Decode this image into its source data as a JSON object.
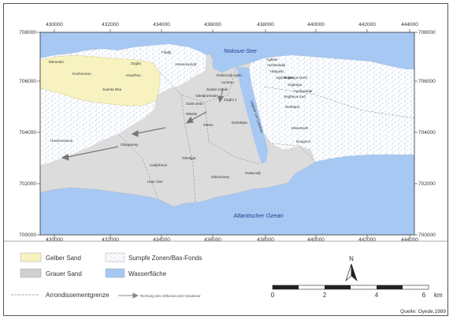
{
  "map": {
    "axes": {
      "x_ticks": [
        "430000",
        "432000",
        "434000",
        "436000",
        "438000",
        "440000",
        "442000",
        "444000"
      ],
      "y_ticks": [
        "708000",
        "706000",
        "704000",
        "702000",
        "700000"
      ]
    },
    "water_labels": {
      "north": "Nokoue-See",
      "south": "Atlantischer Ozean",
      "channel": "Lagune von Cotonou"
    },
    "places": [
      "Menontin",
      "Zogbo",
      "Fifadji",
      "Vossa-Kpodji",
      "Kouhounou",
      "Houehou",
      "Suenta Rita",
      "Abokicodji Agbo",
      "Avotrou",
      "Sainte-Cecile",
      "Gbedjromede",
      "Saint-Jean",
      "Zogbo 1",
      "Missite",
      "Gbeto",
      "Dantokpa",
      "Houenoussou",
      "Gbegamey",
      "Cadjehoun",
      "Gbedjga",
      "Haie Vive",
      "Gbinzomey",
      "Hwlacodji",
      "Agbato",
      "Ayelawadje",
      "Hlagodu",
      "Agontinkon",
      "Sogbeya-Nord",
      "Segbeya",
      "Ayelawadje",
      "Segbeya-Sud",
      "Dedokpo",
      "Missessim",
      "Enagnon"
    ],
    "colors": {
      "yellow_sand": "#f7f2c0",
      "grey_sand": "#dcdcdc",
      "water": "#a6c8f2",
      "swamp": "#ffffff"
    }
  },
  "legend": {
    "yellow_sand": "Gelber Sand",
    "grey_sand": "Grauer Sand",
    "swamp": "Sumpfe Zonen/Bas-Fonds",
    "water": "Wasserfläche",
    "boundary": "Arrondissementgrenze",
    "flow": "Richtung des Abflusses des  Gewässer"
  },
  "north_arrow": {
    "label": "N",
    "icon": "north-arrow-icon"
  },
  "scale_bar": {
    "labels": [
      "0",
      "2",
      "4",
      "6"
    ],
    "unit": "km"
  },
  "source": "Quelle: Oyede,1989"
}
